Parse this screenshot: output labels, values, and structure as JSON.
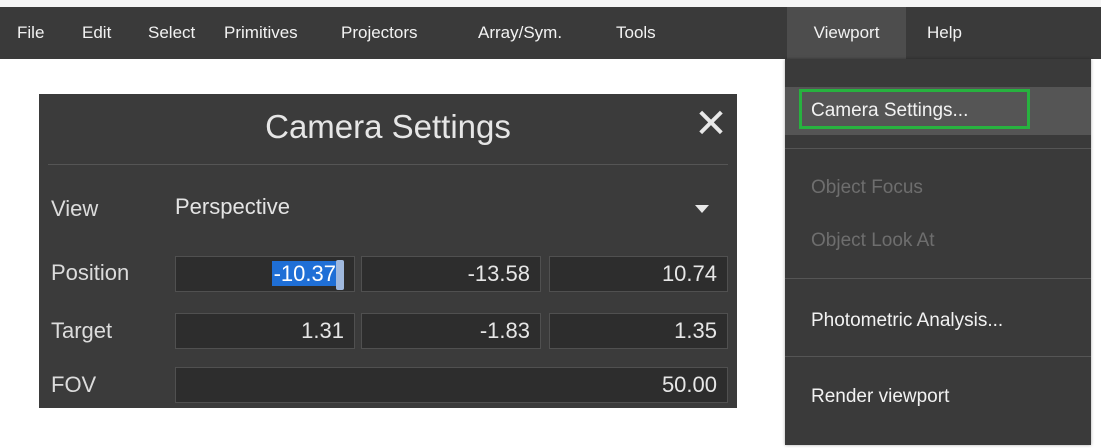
{
  "menubar": {
    "items": [
      {
        "label": "File"
      },
      {
        "label": "Edit"
      },
      {
        "label": "Select"
      },
      {
        "label": "Primitives"
      },
      {
        "label": "Projectors"
      },
      {
        "label": "Array/Sym."
      },
      {
        "label": "Tools"
      },
      {
        "label": "Viewport"
      },
      {
        "label": "Help"
      }
    ],
    "active": "Viewport"
  },
  "dialog": {
    "title": "Camera Settings",
    "close_icon": "close-icon",
    "view_label": "View",
    "view_value": "Perspective",
    "position_label": "Position",
    "position": {
      "x": "-10.37",
      "y": "-13.58",
      "z": "10.74"
    },
    "target_label": "Target",
    "target": {
      "x": "1.31",
      "y": "-1.83",
      "z": "1.35"
    },
    "fov_label": "FOV",
    "fov": "50.00"
  },
  "viewport_menu": {
    "camera_settings": "Camera Settings...",
    "object_focus": "Object Focus",
    "object_look_at": "Object Look At",
    "photometric": "Photometric Analysis...",
    "render": "Render viewport"
  },
  "colors": {
    "menubar_bg": "#3a3a3a",
    "dialog_bg": "#3b3b3b",
    "selection": "#1f6fd6",
    "highlight_border": "#27b23f"
  }
}
